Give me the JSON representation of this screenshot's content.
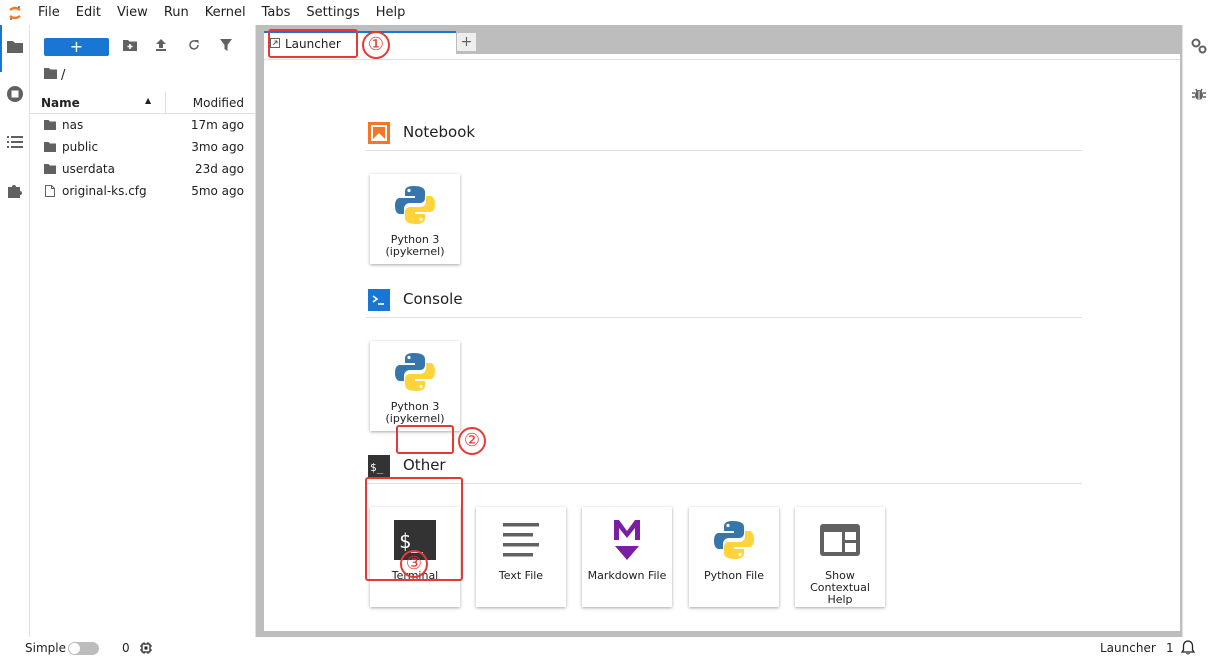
{
  "menubar": {
    "items": [
      "File",
      "Edit",
      "View",
      "Run",
      "Kernel",
      "Tabs",
      "Settings",
      "Help"
    ]
  },
  "left_rail": {
    "icons": [
      "folder-icon",
      "running-sessions-icon",
      "table-of-contents-icon",
      "extension-icon"
    ]
  },
  "filebrowser": {
    "new_label": "+",
    "breadcrumb": "/",
    "columns": {
      "name": "Name",
      "modified": "Modified"
    },
    "files": [
      {
        "type": "folder",
        "name": "nas",
        "modified": "17m ago"
      },
      {
        "type": "folder",
        "name": "public",
        "modified": "3mo ago"
      },
      {
        "type": "folder",
        "name": "userdata",
        "modified": "23d ago"
      },
      {
        "type": "file",
        "name": "original-ks.cfg",
        "modified": "5mo ago"
      }
    ]
  },
  "tabs": {
    "active_label": "Launcher",
    "add_label": "+"
  },
  "launcher": {
    "sections": [
      {
        "title": "Notebook",
        "cards": [
          {
            "label": "Python 3\n(ipykernel)"
          }
        ]
      },
      {
        "title": "Console",
        "cards": [
          {
            "label": "Python 3\n(ipykernel)"
          }
        ]
      },
      {
        "title": "Other",
        "cards": [
          {
            "label": "Terminal"
          },
          {
            "label": "Text File"
          },
          {
            "label": "Markdown File"
          },
          {
            "label": "Python File"
          },
          {
            "label": "Show\nContextual\nHelp"
          }
        ]
      }
    ]
  },
  "annotations": [
    "①",
    "②",
    "③"
  ],
  "statusbar": {
    "simple_label": "Simple",
    "kernel_count": "0",
    "right_label": "Launcher",
    "right_count": "1"
  },
  "colors": {
    "accent": "#1976d2",
    "annotation": "#e53935",
    "notebook_icon": "#f37726",
    "console_icon": "#1976d2",
    "markdown_icon": "#7b1fa2"
  }
}
